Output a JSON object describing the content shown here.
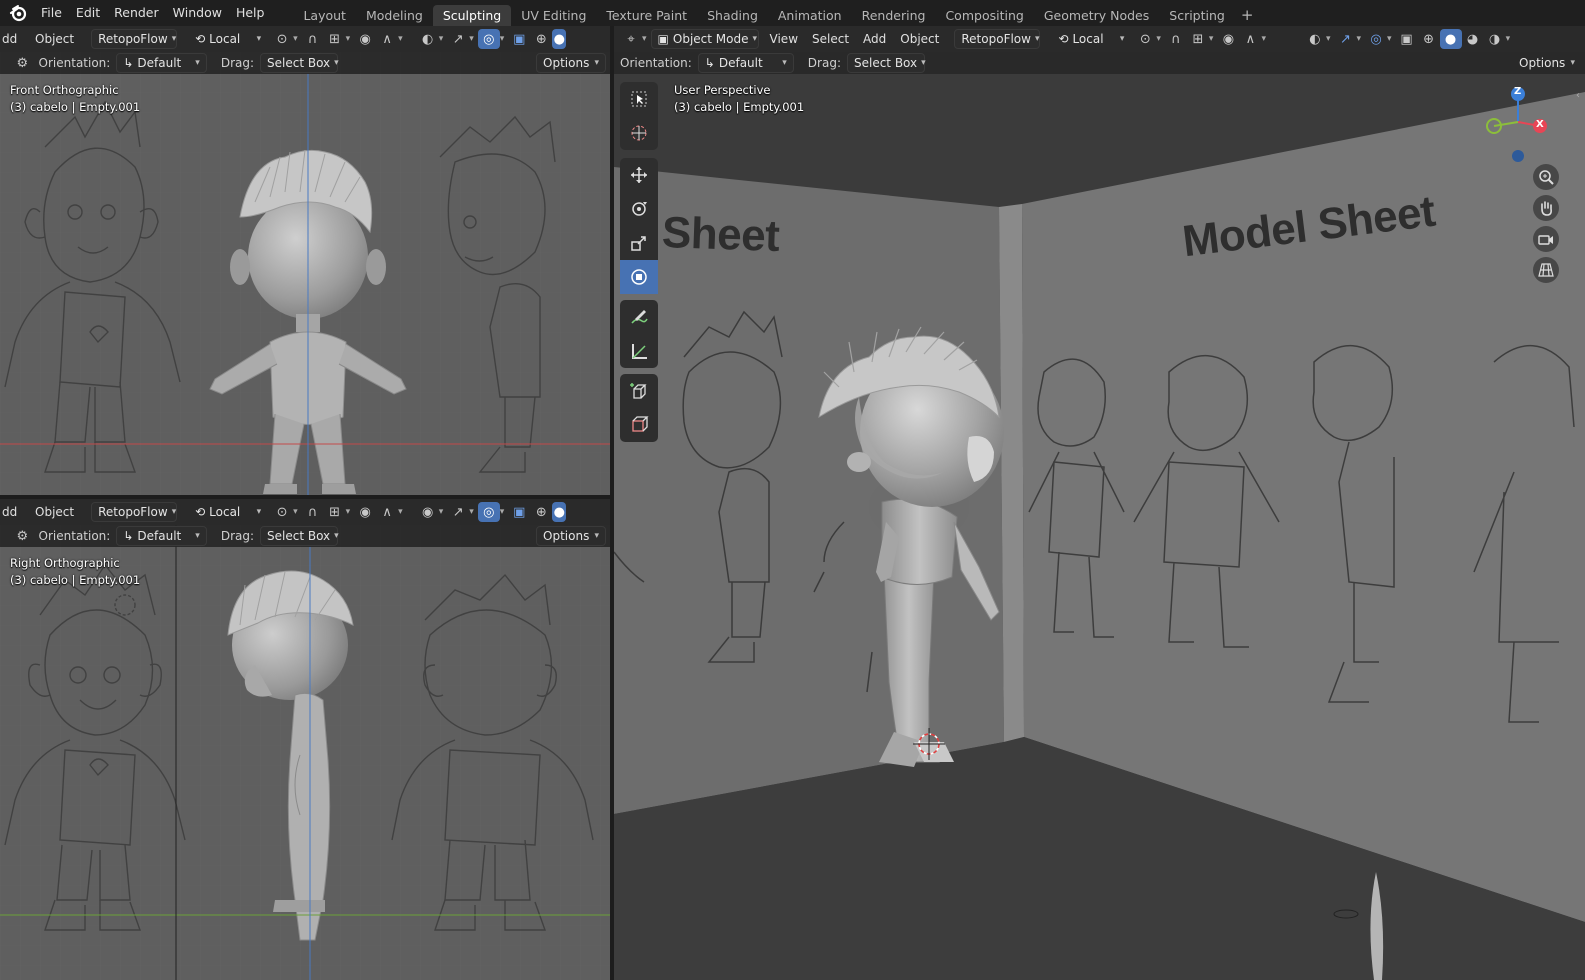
{
  "app": {
    "name": "Blender"
  },
  "menus": [
    "File",
    "Edit",
    "Render",
    "Window",
    "Help"
  ],
  "workspaces": [
    "Layout",
    "Modeling",
    "Sculpting",
    "UV Editing",
    "Texture Paint",
    "Shading",
    "Animation",
    "Rendering",
    "Compositing",
    "Geometry Nodes",
    "Scripting"
  ],
  "active_workspace": "Sculpting",
  "left_header": {
    "add_trunc": "dd",
    "object": "Object",
    "retopo": "RetopoFlow",
    "transform": "Local"
  },
  "tool_settings": {
    "orientation_label": "Orientation:",
    "orientation_value": "Default",
    "drag_label": "Drag:",
    "drag_value": "Select Box",
    "options": "Options"
  },
  "viewport_front": {
    "view": "Front Orthographic",
    "info": "(3) cabelo | Empty.001"
  },
  "viewport_right": {
    "view": "Right Orthographic",
    "info": "(3) cabelo | Empty.001"
  },
  "viewport_persp": {
    "view": "User Perspective",
    "info": "(3) cabelo | Empty.001"
  },
  "right_header": {
    "mode": "Object Mode",
    "view": "View",
    "select": "Select",
    "add": "Add",
    "object": "Object",
    "retopo": "RetopoFlow",
    "transform": "Local"
  },
  "scene_text": {
    "wall_left": "Sheet",
    "wall_right": "Model Sheet"
  },
  "gizmo": {
    "x": "X",
    "y": "Y",
    "z": "Z"
  },
  "colors": {
    "accent": "#4772b3",
    "x_axis": "#e84555",
    "y_axis": "#8cbe3b",
    "z_axis": "#3b7fd8"
  },
  "toolbar_icons": [
    "select-box-icon",
    "cursor-icon",
    "move-icon",
    "rotate-icon",
    "scale-icon",
    "transform-icon",
    "annotate-icon",
    "measure-icon",
    "add-cube-icon",
    "add-primitive-icon"
  ],
  "nav_icons": [
    "zoom-icon",
    "pan-hand-icon",
    "camera-icon",
    "perspective-grid-icon"
  ]
}
